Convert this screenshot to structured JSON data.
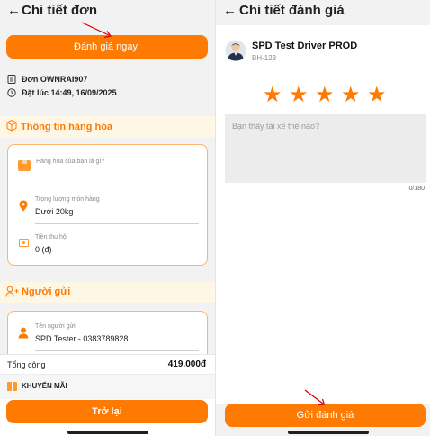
{
  "left": {
    "header": {
      "back_glyph": "←",
      "title": "Chi tiết đơn"
    },
    "rate_now_button": "Đánh giá ngay!",
    "order": {
      "code": "Đơn OWNRAI907",
      "placed_at": "Đặt lúc 14:49, 16/09/2025"
    },
    "goods_section": {
      "title": "Thông tin hàng hóa",
      "fields": [
        {
          "label": "Hàng hóa của bạn là gì?",
          "value": ""
        },
        {
          "label": "Trọng lượng món hàng",
          "value": "Dưới 20kg"
        },
        {
          "label": "Tiền thu hộ",
          "value": "0 (đ)"
        }
      ]
    },
    "sender_section": {
      "title": "Người gửi",
      "fields": [
        {
          "label": "Tên người gửi",
          "value": "SPD Tester - 0383789828"
        }
      ]
    },
    "total": {
      "label": "Tổng cộng",
      "value": "419.000đ"
    },
    "promo": "KHUYẾN MÃI",
    "back_button": "Trở lại"
  },
  "right": {
    "header": {
      "back_glyph": "←",
      "title": "Chi tiết đánh giá"
    },
    "driver": {
      "name": "SPD Test Driver PROD",
      "plate": "BH-123"
    },
    "rating": {
      "stars_filled": 5,
      "stars_total": 5
    },
    "comment": {
      "placeholder": "Bạn thấy tài xế thế nào?",
      "counter": "0/180"
    },
    "submit_button": "Gửi đánh giá"
  },
  "colors": {
    "accent": "#ff7a00",
    "annotation_arrow": "#cc0000"
  }
}
